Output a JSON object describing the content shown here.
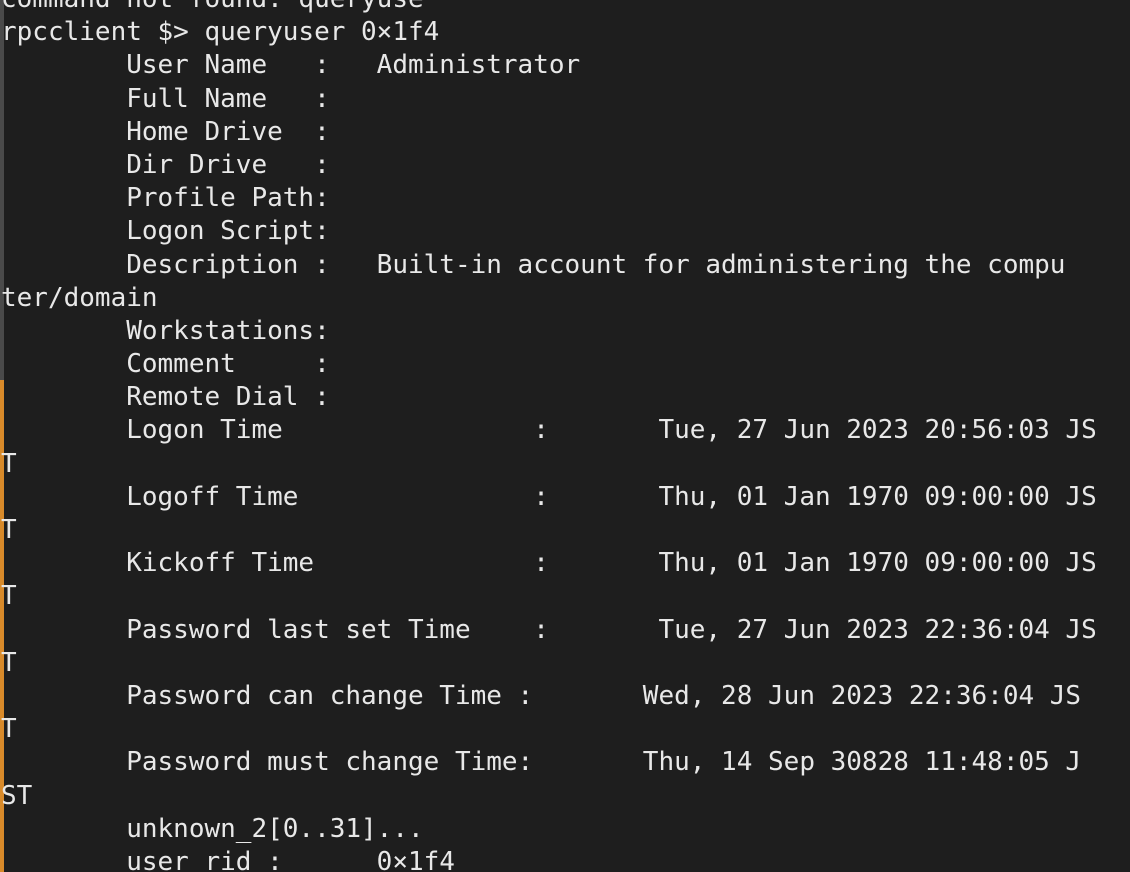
{
  "terminal": {
    "lines": [
      "command not found: queryuse",
      "rpcclient $> queryuser 0×1f4",
      "        User Name   :   Administrator",
      "        Full Name   :",
      "        Home Drive  :",
      "        Dir Drive   :",
      "        Profile Path:",
      "        Logon Script:",
      "        Description :   Built-in account for administering the compu",
      "ter/domain",
      "        Workstations:",
      "        Comment     :",
      "        Remote Dial :",
      "        Logon Time                :       Tue, 27 Jun 2023 20:56:03 JS",
      "T",
      "        Logoff Time               :       Thu, 01 Jan 1970 09:00:00 JS",
      "T",
      "        Kickoff Time              :       Thu, 01 Jan 1970 09:00:00 JS",
      "T",
      "        Password last set Time    :       Tue, 27 Jun 2023 22:36:04 JS",
      "T",
      "        Password can change Time :       Wed, 28 Jun 2023 22:36:04 JS",
      "T",
      "        Password must change Time:       Thu, 14 Sep 30828 11:48:05 J",
      "ST",
      "        unknown_2[0..31]...",
      "        user rid :      0×1f4"
    ],
    "colors": {
      "background": "#1e1e1e",
      "text": "#e8e8e8",
      "gutter_upper": "#4a4a4a",
      "gutter_lower": "#d88a2a"
    }
  }
}
